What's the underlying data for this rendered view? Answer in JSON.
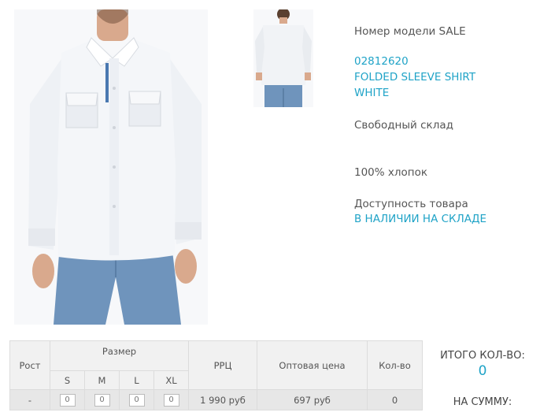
{
  "product": {
    "model_line": "Номер модели SALE",
    "sku": "02812620",
    "name_line1": "FOLDED SLEEVE SHIRT",
    "name_line2": "WHITE",
    "fit": "Свободный склад",
    "material": "100% хлопок",
    "availability_label": "Доступность товара",
    "availability_value": "В НАЛИЧИИ НА СКЛАДЕ"
  },
  "table": {
    "col_height": "Рост",
    "col_size": "Размер",
    "sizes": [
      "S",
      "M",
      "L",
      "XL"
    ],
    "col_rrp": "РРЦ",
    "col_wholesale": "Оптовая цена",
    "col_qty": "Кол-во",
    "row": {
      "height": "-",
      "quantities": [
        "0",
        "0",
        "0",
        "0"
      ],
      "rrp": "1 990 руб",
      "wholesale": "697 руб",
      "qty": "0"
    }
  },
  "totals": {
    "total_qty_label": "ИТОГО КОЛ-ВО:",
    "total_qty_value": "0",
    "sum_label": "НА СУММУ:"
  },
  "colors": {
    "accent": "#1fa3c7",
    "shirt": "#f4f6f9",
    "jeans": "#6f94bc"
  }
}
